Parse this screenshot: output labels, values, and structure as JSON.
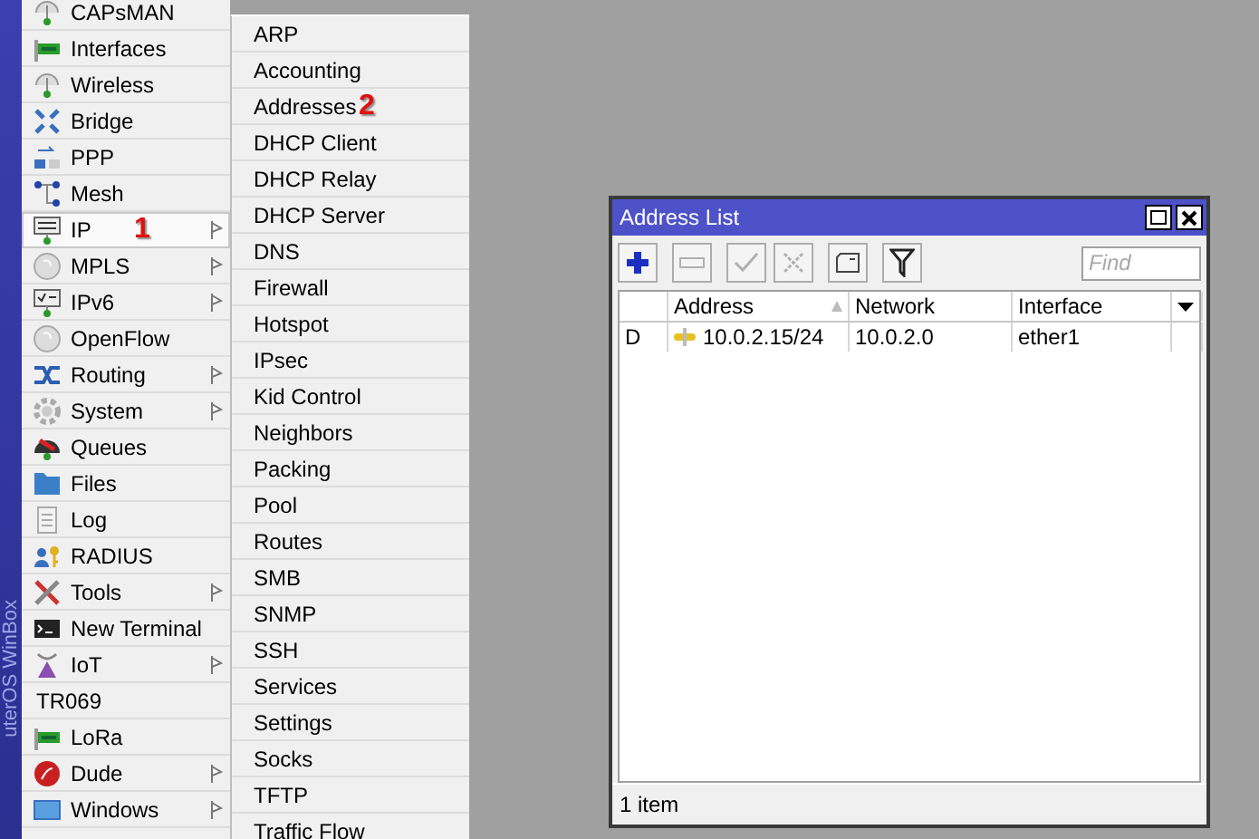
{
  "brand_strip": {
    "text": "uterOS WinBox"
  },
  "sidebar": {
    "items": [
      {
        "label": "CAPsMAN",
        "has_submenu": false,
        "selected": false
      },
      {
        "label": "Interfaces",
        "has_submenu": false,
        "selected": false
      },
      {
        "label": "Wireless",
        "has_submenu": false,
        "selected": false
      },
      {
        "label": "Bridge",
        "has_submenu": false,
        "selected": false
      },
      {
        "label": "PPP",
        "has_submenu": false,
        "selected": false
      },
      {
        "label": "Mesh",
        "has_submenu": false,
        "selected": false
      },
      {
        "label": "IP",
        "has_submenu": true,
        "selected": true,
        "annotation": "1"
      },
      {
        "label": "MPLS",
        "has_submenu": true,
        "selected": false
      },
      {
        "label": "IPv6",
        "has_submenu": true,
        "selected": false
      },
      {
        "label": "OpenFlow",
        "has_submenu": false,
        "selected": false
      },
      {
        "label": "Routing",
        "has_submenu": true,
        "selected": false
      },
      {
        "label": "System",
        "has_submenu": true,
        "selected": false
      },
      {
        "label": "Queues",
        "has_submenu": false,
        "selected": false
      },
      {
        "label": "Files",
        "has_submenu": false,
        "selected": false
      },
      {
        "label": "Log",
        "has_submenu": false,
        "selected": false
      },
      {
        "label": "RADIUS",
        "has_submenu": false,
        "selected": false
      },
      {
        "label": "Tools",
        "has_submenu": true,
        "selected": false
      },
      {
        "label": "New Terminal",
        "has_submenu": false,
        "selected": false
      },
      {
        "label": "IoT",
        "has_submenu": true,
        "selected": false
      },
      {
        "label": "TR069",
        "has_submenu": false,
        "selected": false
      },
      {
        "label": "LoRa",
        "has_submenu": false,
        "selected": false
      },
      {
        "label": "Dude",
        "has_submenu": true,
        "selected": false
      },
      {
        "label": "Windows",
        "has_submenu": true,
        "selected": false
      }
    ]
  },
  "submenu": {
    "items": [
      {
        "label": "ARP"
      },
      {
        "label": "Accounting"
      },
      {
        "label": "Addresses",
        "annotation": "2"
      },
      {
        "label": "DHCP Client"
      },
      {
        "label": "DHCP Relay"
      },
      {
        "label": "DHCP Server"
      },
      {
        "label": "DNS"
      },
      {
        "label": "Firewall"
      },
      {
        "label": "Hotspot"
      },
      {
        "label": "IPsec"
      },
      {
        "label": "Kid Control"
      },
      {
        "label": "Neighbors"
      },
      {
        "label": "Packing"
      },
      {
        "label": "Pool"
      },
      {
        "label": "Routes"
      },
      {
        "label": "SMB"
      },
      {
        "label": "SNMP"
      },
      {
        "label": "SSH"
      },
      {
        "label": "Services"
      },
      {
        "label": "Settings"
      },
      {
        "label": "Socks"
      },
      {
        "label": "TFTP"
      },
      {
        "label": "Traffic Flow"
      }
    ]
  },
  "window": {
    "title": "Address List",
    "toolbar": [
      {
        "kind": "add",
        "disabled": false
      },
      {
        "kind": "remove",
        "disabled": true
      },
      {
        "kind": "enable",
        "disabled": true
      },
      {
        "kind": "disable",
        "disabled": true
      },
      {
        "kind": "comment",
        "disabled": false
      },
      {
        "kind": "filter",
        "disabled": false
      }
    ],
    "search": {
      "placeholder": "Find"
    },
    "table": {
      "columns": [
        {
          "label": "Address",
          "sorted": true
        },
        {
          "label": "Network",
          "sorted": false
        },
        {
          "label": "Interface",
          "sorted": false
        }
      ],
      "rows": [
        {
          "flag": "D",
          "address": "10.0.2.15/24",
          "network": "10.0.2.0",
          "interface": "ether1"
        }
      ]
    },
    "status_bar": "1 item"
  }
}
